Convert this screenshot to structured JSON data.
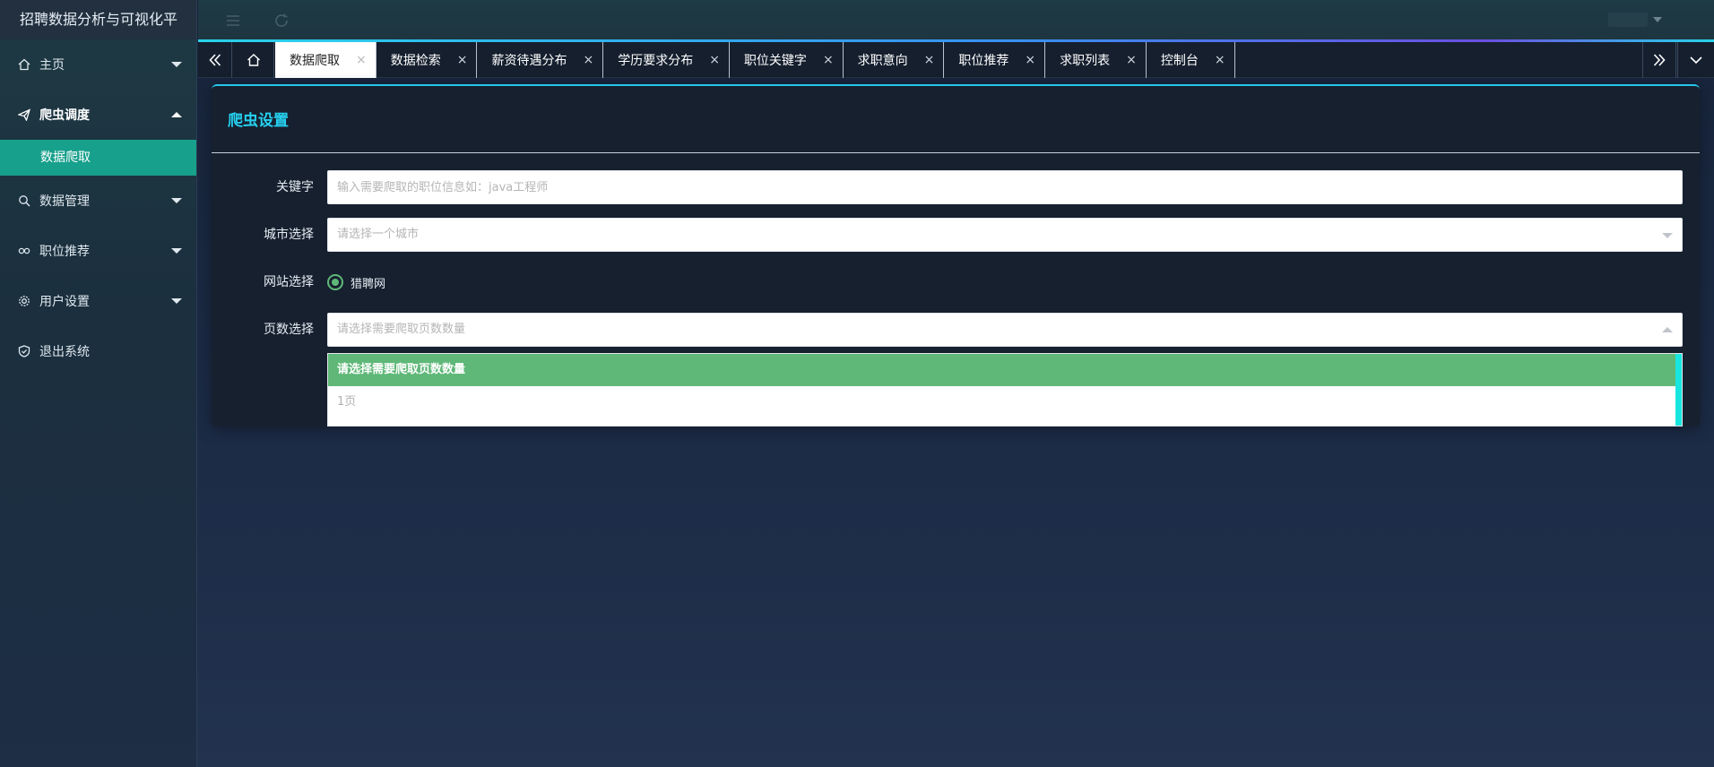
{
  "app": {
    "title": "招聘数据分析与可视化平"
  },
  "sidebar": {
    "items": [
      {
        "label": "主页",
        "icon": "home-icon",
        "state": "collapsed"
      },
      {
        "label": "爬虫调度",
        "icon": "send-icon",
        "state": "expanded",
        "children": [
          {
            "label": "数据爬取",
            "active": true
          }
        ]
      },
      {
        "label": "数据管理",
        "icon": "search-icon",
        "state": "collapsed"
      },
      {
        "label": "职位推荐",
        "icon": "link-icon",
        "state": "collapsed"
      },
      {
        "label": "用户设置",
        "icon": "gear-icon",
        "state": "collapsed"
      },
      {
        "label": "退出系统",
        "icon": "shield-icon"
      }
    ]
  },
  "tabs": [
    {
      "label": "数据爬取",
      "active": true
    },
    {
      "label": "数据检索"
    },
    {
      "label": "薪资待遇分布"
    },
    {
      "label": "学历要求分布"
    },
    {
      "label": "职位关键字"
    },
    {
      "label": "求职意向"
    },
    {
      "label": "职位推荐"
    },
    {
      "label": "求职列表"
    },
    {
      "label": "控制台"
    }
  ],
  "tab_close_glyph": "×",
  "panel": {
    "title": "爬虫设置",
    "form": {
      "keyword": {
        "label": "关键字",
        "value": "",
        "placeholder": "输入需要爬取的职位信息如：java工程师"
      },
      "city": {
        "label": "城市选择",
        "placeholder": "请选择一个城市"
      },
      "site": {
        "label": "网站选择",
        "options": [
          {
            "label": "猎聘网",
            "checked": true
          }
        ]
      },
      "pages": {
        "label": "页数选择",
        "placeholder": "请选择需要爬取页数数量",
        "open": true,
        "options": [
          "请选择需要爬取页数数量",
          "1页"
        ]
      }
    }
  },
  "colors": {
    "accent": "#26d0ef",
    "sidebar_active": "#17a08c",
    "selected_option": "#5fb878",
    "scrollbar": "#17e6e0"
  }
}
